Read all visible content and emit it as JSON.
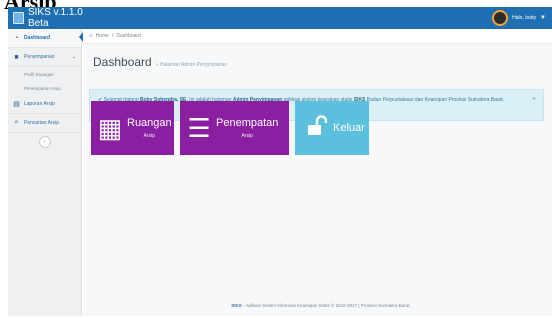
{
  "document": {
    "heading": "Arsip"
  },
  "topbar": {
    "app_title": "SIKS v.1.1.0 Beta",
    "user_greeting": "Halo, boby",
    "brand_color": "#1f6fb3"
  },
  "sidebar": {
    "items": [
      {
        "label": "Dashboard",
        "icon": "dashboard-icon",
        "active": true
      },
      {
        "label": "Penyimpanan",
        "icon": "archive-icon",
        "expanded": true,
        "children": [
          "Profil Ruangan",
          "Penempatan Arsip"
        ]
      },
      {
        "label": "Laporan Arsip",
        "icon": "report-icon"
      },
      {
        "label": "Pencarian Arsip",
        "icon": "search-icon"
      }
    ],
    "collapse_icon": "collapse-icon"
  },
  "breadcrumb": {
    "home": "Home",
    "separator": "/",
    "current": "Dashboard"
  },
  "page": {
    "title": "Dashboard",
    "subtitle": "» Halaman Admin Penyimpanan"
  },
  "alert": {
    "prefix": "✔ Selamat datang",
    "user": "Boby Sohendra, SE",
    "mid": ". Ini adalah halaman",
    "role": "Admin Penyimpanan",
    "mid2": "aplikasi sistem kearsipan statis",
    "app": "SIKS",
    "suffix": "Badan Perpustakaan dan Kearsipan Provinsi Sumatera Barat.",
    "close": "×"
  },
  "tiles": [
    {
      "label": "Ruangan",
      "sub": "Arsip",
      "icon": "building-icon",
      "color": "#8a1fa2"
    },
    {
      "label": "Penempatan",
      "sub": "Arsip",
      "icon": "list-icon",
      "color": "#8a1fa2"
    },
    {
      "label": "Keluar",
      "sub": "",
      "icon": "unlock-icon",
      "color": "#5bc0de"
    }
  ],
  "footer": {
    "app": "SIKS",
    "text": "- Aplikasi Sistem Informasi Kearsipan Statis © 2016-2017 | Provinsi Sumatera Barat."
  }
}
